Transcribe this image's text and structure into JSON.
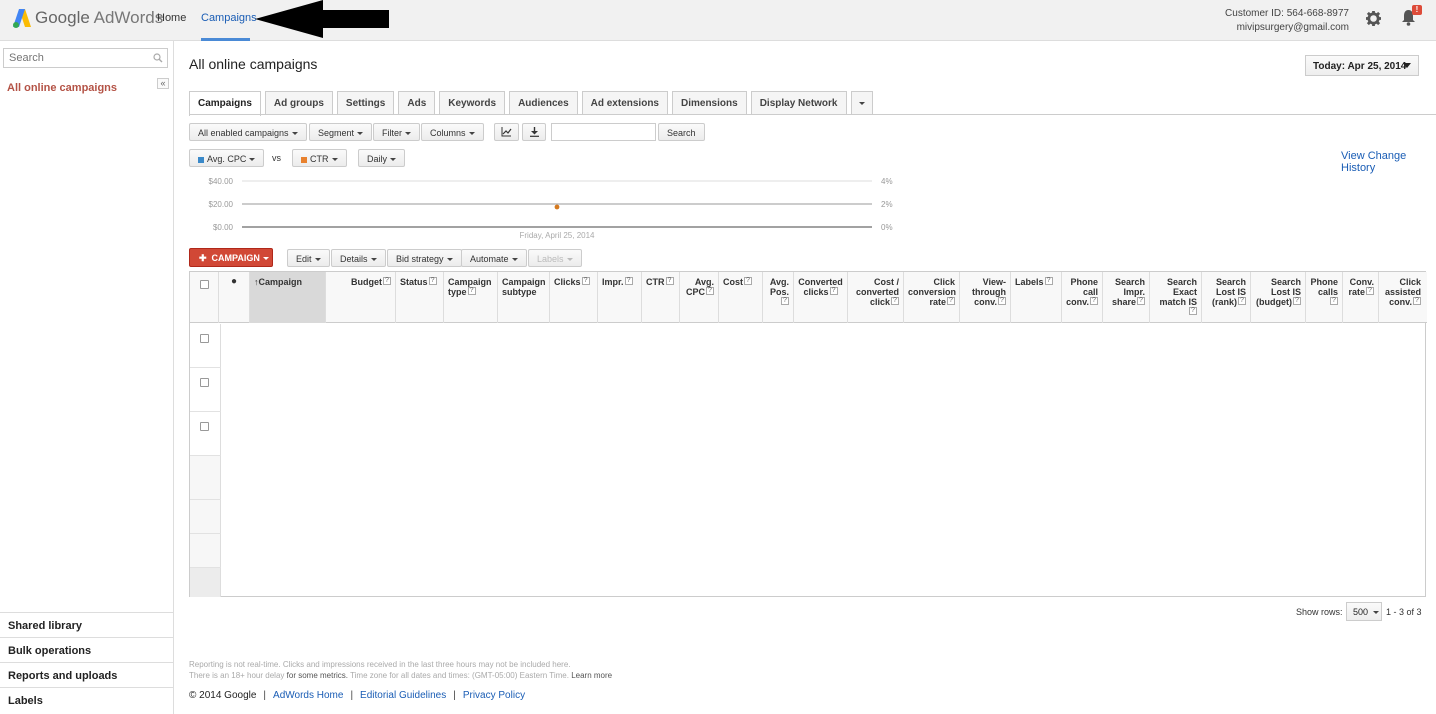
{
  "app": {
    "brand_google": "Google",
    "brand_adwords": "AdWords"
  },
  "nav": {
    "home": "Home",
    "campaigns": "Campaigns"
  },
  "account": {
    "customer_id": "Customer ID: 564-668-8977",
    "email": "mivipsurgery@gmail.com",
    "notification_count": "!"
  },
  "sidebar": {
    "search_placeholder": "Search",
    "collapse": "«",
    "selected": "All online campaigns",
    "bottom_links": [
      "Shared library",
      "Bulk operations",
      "Reports and uploads",
      "Labels"
    ]
  },
  "main": {
    "title": "All online campaigns",
    "date_range": "Today: Apr 25, 2014",
    "tabs": [
      "Campaigns",
      "Ad groups",
      "Settings",
      "Ads",
      "Keywords",
      "Audiences",
      "Ad extensions",
      "Dimensions",
      "Display Network"
    ],
    "toolbar": {
      "filter_enabled": "All enabled campaigns",
      "segment": "Segment",
      "filter": "Filter",
      "columns": "Columns",
      "search_button": "Search"
    },
    "chart_controls": {
      "metric1": "Avg. CPC",
      "vs": "vs",
      "metric2": "CTR",
      "period": "Daily"
    },
    "view_change_history": "View Change History",
    "chart": {
      "left_ticks": [
        "$40.00",
        "$20.00",
        "$0.00"
      ],
      "right_ticks": [
        "4%",
        "2%",
        "0%"
      ],
      "date_label": "Friday, April 25, 2014"
    },
    "actions": {
      "campaign": "CAMPAIGN",
      "edit": "Edit",
      "details": "Details",
      "bid_strategy": "Bid strategy",
      "automate": "Automate",
      "labels": "Labels"
    },
    "table": {
      "columns": [
        {
          "label": "Campaign"
        },
        {
          "label": "Budget"
        },
        {
          "label": "Status"
        },
        {
          "label": "Campaign type"
        },
        {
          "label": "Campaign subtype"
        },
        {
          "label": "Clicks"
        },
        {
          "label": "Impr."
        },
        {
          "label": "CTR"
        },
        {
          "label": "Avg. CPC"
        },
        {
          "label": "Cost"
        },
        {
          "label": "Avg. Pos."
        },
        {
          "label": "Converted clicks"
        },
        {
          "label": "Cost / converted click"
        },
        {
          "label": "Click conversion rate"
        },
        {
          "label": "View-through conv."
        },
        {
          "label": "Labels"
        },
        {
          "label": "Phone call conv."
        },
        {
          "label": "Search Impr. share"
        },
        {
          "label": "Search Exact match IS"
        },
        {
          "label": "Search Lost IS (rank)"
        },
        {
          "label": "Search Lost IS (budget)"
        },
        {
          "label": "Phone calls"
        },
        {
          "label": "Conv. rate"
        },
        {
          "label": "Click assisted conv."
        }
      ]
    },
    "pager": {
      "show_rows_label": "Show rows:",
      "rows": "500",
      "range": "1 - 3 of 3"
    },
    "fine_print": {
      "line1": "Reporting is not real-time. Clicks and impressions received in the last three hours may not be included here.",
      "line2_a": "There is an 18+ hour delay",
      "line2_b": "for some metrics.",
      "line2_c": "Time zone for all dates and times: (GMT-05:00) Eastern Time.",
      "learn_more": "Learn more"
    },
    "footer": {
      "copyright": "© 2014 Google",
      "links": [
        "AdWords Home",
        "Editorial Guidelines",
        "Privacy Policy"
      ],
      "sep": "|"
    }
  }
}
